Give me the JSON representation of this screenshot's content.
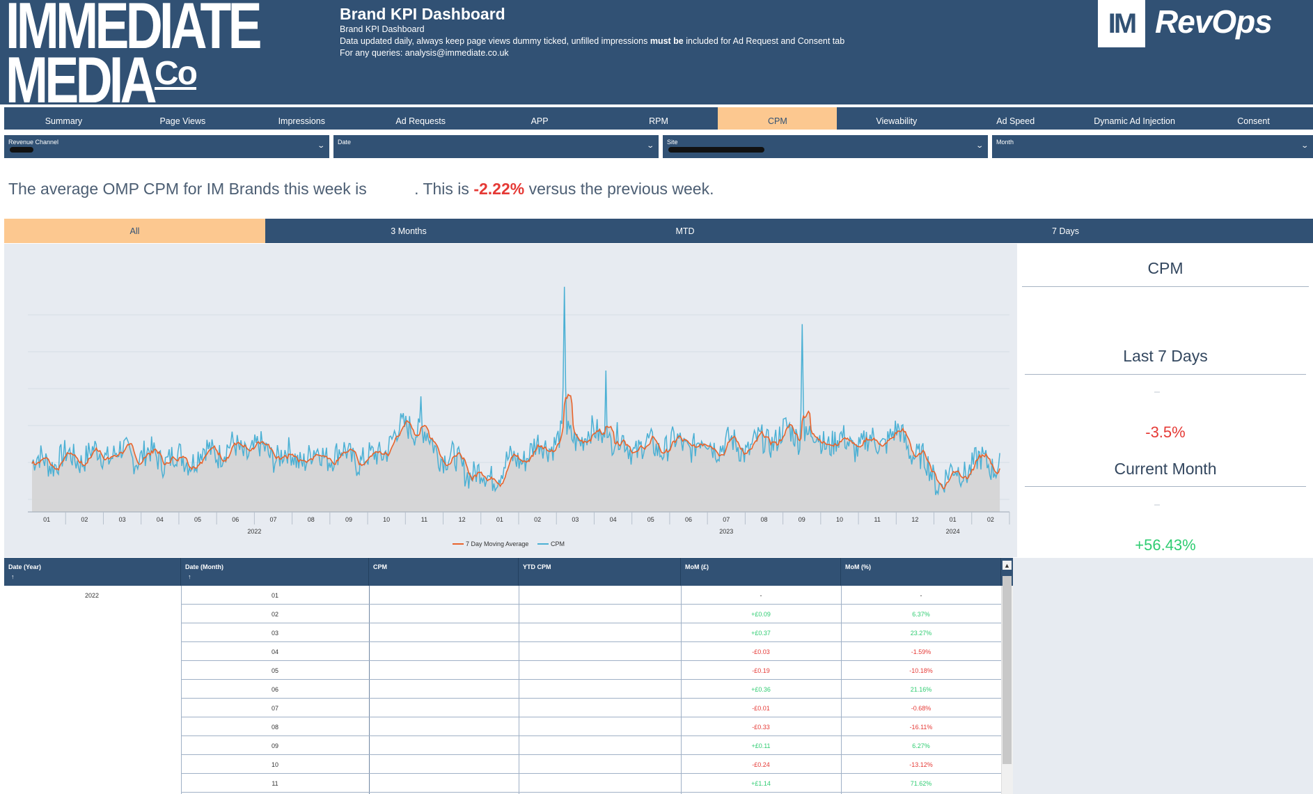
{
  "header": {
    "logo_line1": "IMMEDIATE",
    "logo_line2": "MEDIA",
    "logo_co": "Co",
    "title": "Brand KPI Dashboard",
    "subtitle": "Brand KPI Dashboard",
    "note_before": "Data updated daily, always keep page views dummy ticked, unfilled impressions ",
    "note_bold": "must be",
    "note_after": " included for Ad Request and Consent tab",
    "queries": "For any queries: analysis@immediate.co.uk",
    "revops_box": "IM",
    "revops_text": "RevOps"
  },
  "nav": {
    "items": [
      "Summary",
      "Page Views",
      "Impressions",
      "Ad Requests",
      "APP",
      "RPM",
      "CPM",
      "Viewability",
      "Ad Speed",
      "Dynamic Ad Injection",
      "Consent"
    ],
    "active": "CPM"
  },
  "filters": [
    {
      "label": "Revenue Channel"
    },
    {
      "label": "Date"
    },
    {
      "label": "Site"
    },
    {
      "label": "Month"
    }
  ],
  "summary": {
    "part1": "The average OMP CPM for IM Brands this week is ",
    "part2": ". This is ",
    "change": "-2.22%",
    "part3": " versus the previous week."
  },
  "period_tabs": {
    "items": [
      "All",
      "3 Months",
      "MTD",
      "7 Days"
    ],
    "active": "All"
  },
  "kpi": {
    "title": "CPM",
    "last7_label": "Last 7 Days",
    "last7_value": "-3.5%",
    "month_label": "Current Month",
    "month_value": "+56.43%"
  },
  "chart_data": {
    "type": "line",
    "x_month_labels": [
      "01",
      "02",
      "03",
      "04",
      "05",
      "06",
      "07",
      "08",
      "09",
      "10",
      "11",
      "12",
      "01",
      "02",
      "03",
      "04",
      "05",
      "06",
      "07",
      "08",
      "09",
      "10",
      "11",
      "12",
      "01",
      "02"
    ],
    "x_year_labels": [
      "2022",
      "2023",
      "2024"
    ],
    "legend": [
      "7 Day Moving Average",
      "CPM"
    ],
    "series": [
      {
        "name": "7 Day Moving Average",
        "color": "#e8632b"
      },
      {
        "name": "CPM",
        "color": "#4bb0d4"
      }
    ],
    "monthly_level": [
      0.58,
      0.62,
      0.66,
      0.64,
      0.61,
      0.69,
      0.68,
      0.62,
      0.66,
      0.6,
      0.9,
      0.62,
      0.46,
      0.64,
      0.78,
      0.8,
      0.7,
      0.72,
      0.74,
      0.7,
      0.82,
      0.76,
      0.72,
      0.8,
      0.44,
      0.58
    ],
    "spikes": [
      {
        "month": 14.1,
        "level": 1.95
      },
      {
        "month": 15.2,
        "level": 1.3
      },
      {
        "month": 20.4,
        "level": 1.66
      },
      {
        "month": 10.3,
        "level": 1.1
      }
    ],
    "grid": true
  },
  "table": {
    "columns": [
      "Date (Year)",
      "Date (Month)",
      "CPM",
      "YTD CPM",
      "MoM (£)",
      "MoM (%)"
    ],
    "sort_arrow": "↑",
    "year": "2022",
    "rows": [
      {
        "month": "01",
        "mom_gbp": "-",
        "mom_pct": "-",
        "sign": "none"
      },
      {
        "month": "02",
        "mom_gbp": "+£0.09",
        "mom_pct": "6.37%",
        "sign": "pos"
      },
      {
        "month": "03",
        "mom_gbp": "+£0.37",
        "mom_pct": "23.27%",
        "sign": "pos"
      },
      {
        "month": "04",
        "mom_gbp": "-£0.03",
        "mom_pct": "-1.59%",
        "sign": "neg"
      },
      {
        "month": "05",
        "mom_gbp": "-£0.19",
        "mom_pct": "-10.18%",
        "sign": "neg"
      },
      {
        "month": "06",
        "mom_gbp": "+£0.36",
        "mom_pct": "21.16%",
        "sign": "pos"
      },
      {
        "month": "07",
        "mom_gbp": "-£0.01",
        "mom_pct": "-0.68%",
        "sign": "neg"
      },
      {
        "month": "08",
        "mom_gbp": "-£0.33",
        "mom_pct": "-16.11%",
        "sign": "neg"
      },
      {
        "month": "09",
        "mom_gbp": "+£0.11",
        "mom_pct": "6.27%",
        "sign": "pos"
      },
      {
        "month": "10",
        "mom_gbp": "-£0.24",
        "mom_pct": "-13.12%",
        "sign": "neg"
      },
      {
        "month": "11",
        "mom_gbp": "+£1.14",
        "mom_pct": "71.62%",
        "sign": "pos"
      }
    ]
  }
}
